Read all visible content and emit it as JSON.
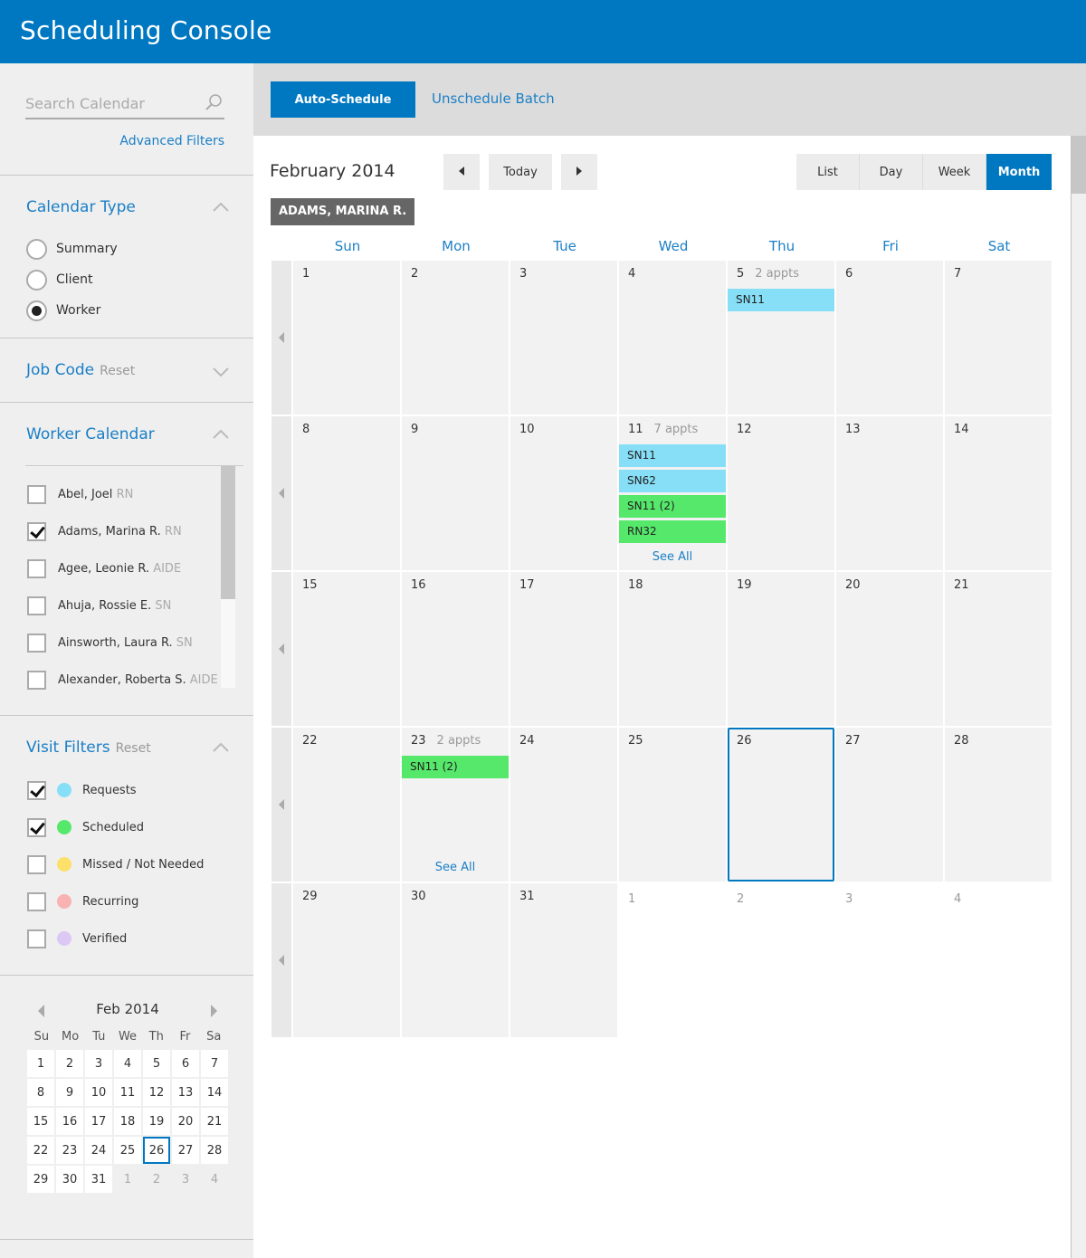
{
  "app": {
    "title": "Scheduling Console"
  },
  "sidebar": {
    "search": {
      "placeholder": "Search Calendar",
      "value": ""
    },
    "advanced_filters": "Advanced Filters",
    "calendar_type": {
      "title": "Calendar Type",
      "options": [
        {
          "label": "Summary",
          "selected": false
        },
        {
          "label": "Client",
          "selected": false
        },
        {
          "label": "Worker",
          "selected": true
        }
      ]
    },
    "job_code": {
      "title": "Job Code",
      "reset": "Reset"
    },
    "worker_calendar": {
      "title": "Worker Calendar",
      "workers": [
        {
          "name": "Abel, Joel",
          "role": "RN",
          "checked": false
        },
        {
          "name": "Adams, Marina R.",
          "role": "RN",
          "checked": true
        },
        {
          "name": "Agee, Leonie R.",
          "role": "AIDE",
          "checked": false
        },
        {
          "name": "Ahuja, Rossie E.",
          "role": "SN",
          "checked": false
        },
        {
          "name": "Ainsworth, Laura R.",
          "role": "SN",
          "checked": false
        },
        {
          "name": "Alexander, Roberta S.",
          "role": "AIDE",
          "checked": false
        }
      ]
    },
    "visit_filters": {
      "title": "Visit Filters",
      "reset": "Reset",
      "items": [
        {
          "label": "Requests",
          "color": "#86dff7",
          "checked": true
        },
        {
          "label": "Scheduled",
          "color": "#55e86a",
          "checked": true
        },
        {
          "label": "Missed / Not Needed",
          "color": "#fde06a",
          "checked": false
        },
        {
          "label": "Recurring",
          "color": "#f9b2b2",
          "checked": false
        },
        {
          "label": "Verified",
          "color": "#dcc8f5",
          "checked": false
        }
      ]
    },
    "mini_calendar": {
      "title": "Feb 2014",
      "dows": [
        "Su",
        "Mo",
        "Tu",
        "We",
        "Th",
        "Fr",
        "Sa"
      ],
      "days": [
        [
          "1",
          "2",
          "3",
          "4",
          "5",
          "6",
          "7"
        ],
        [
          "8",
          "9",
          "10",
          "11",
          "12",
          "13",
          "14"
        ],
        [
          "15",
          "16",
          "17",
          "18",
          "19",
          "20",
          "21"
        ],
        [
          "22",
          "23",
          "24",
          "25",
          "26",
          "27",
          "28"
        ],
        [
          "29",
          "30",
          "31",
          "1",
          "2",
          "3",
          "4"
        ]
      ],
      "today": "26"
    }
  },
  "toolbar": {
    "auto_schedule": "Auto-Schedule",
    "unschedule_batch": "Unschedule Batch"
  },
  "calendar": {
    "month_title": "February 2014",
    "today_label": "Today",
    "views": [
      {
        "label": "List",
        "active": false
      },
      {
        "label": "Day",
        "active": false
      },
      {
        "label": "Week",
        "active": false
      },
      {
        "label": "Month",
        "active": true
      }
    ],
    "worker_tag": "ADAMS, MARINA R.",
    "dows": [
      "Sun",
      "Mon",
      "Tue",
      "Wed",
      "Thu",
      "Fri",
      "Sat"
    ],
    "see_all_label": "See All",
    "colors": {
      "request": "#86dff7",
      "scheduled": "#55e86a",
      "today_border": "#0078c1"
    },
    "weeks": [
      [
        {
          "num": "1"
        },
        {
          "num": "2"
        },
        {
          "num": "3"
        },
        {
          "num": "4"
        },
        {
          "num": "5",
          "appts": "2 appts",
          "events": [
            {
              "label": "SN11",
              "type": "request"
            }
          ]
        },
        {
          "num": "6"
        },
        {
          "num": "7"
        }
      ],
      [
        {
          "num": "8"
        },
        {
          "num": "9"
        },
        {
          "num": "10"
        },
        {
          "num": "11",
          "appts": "7 appts",
          "see_all": true,
          "events": [
            {
              "label": "SN11",
              "type": "request"
            },
            {
              "label": "SN62",
              "type": "request"
            },
            {
              "label": "SN11 (2)",
              "type": "scheduled"
            },
            {
              "label": "RN32",
              "type": "scheduled"
            }
          ]
        },
        {
          "num": "12"
        },
        {
          "num": "13"
        },
        {
          "num": "14"
        }
      ],
      [
        {
          "num": "15"
        },
        {
          "num": "16"
        },
        {
          "num": "17"
        },
        {
          "num": "18"
        },
        {
          "num": "19"
        },
        {
          "num": "20"
        },
        {
          "num": "21"
        }
      ],
      [
        {
          "num": "22"
        },
        {
          "num": "23",
          "appts": "2 appts",
          "see_all": true,
          "events": [
            {
              "label": "SN11 (2)",
              "type": "scheduled"
            }
          ]
        },
        {
          "num": "24"
        },
        {
          "num": "25"
        },
        {
          "num": "26",
          "today": true
        },
        {
          "num": "27"
        },
        {
          "num": "28"
        }
      ],
      [
        {
          "num": "29"
        },
        {
          "num": "30"
        },
        {
          "num": "31"
        },
        {
          "num": "1",
          "other": true
        },
        {
          "num": "2",
          "other": true
        },
        {
          "num": "3",
          "other": true
        },
        {
          "num": "4",
          "other": true
        }
      ]
    ]
  }
}
